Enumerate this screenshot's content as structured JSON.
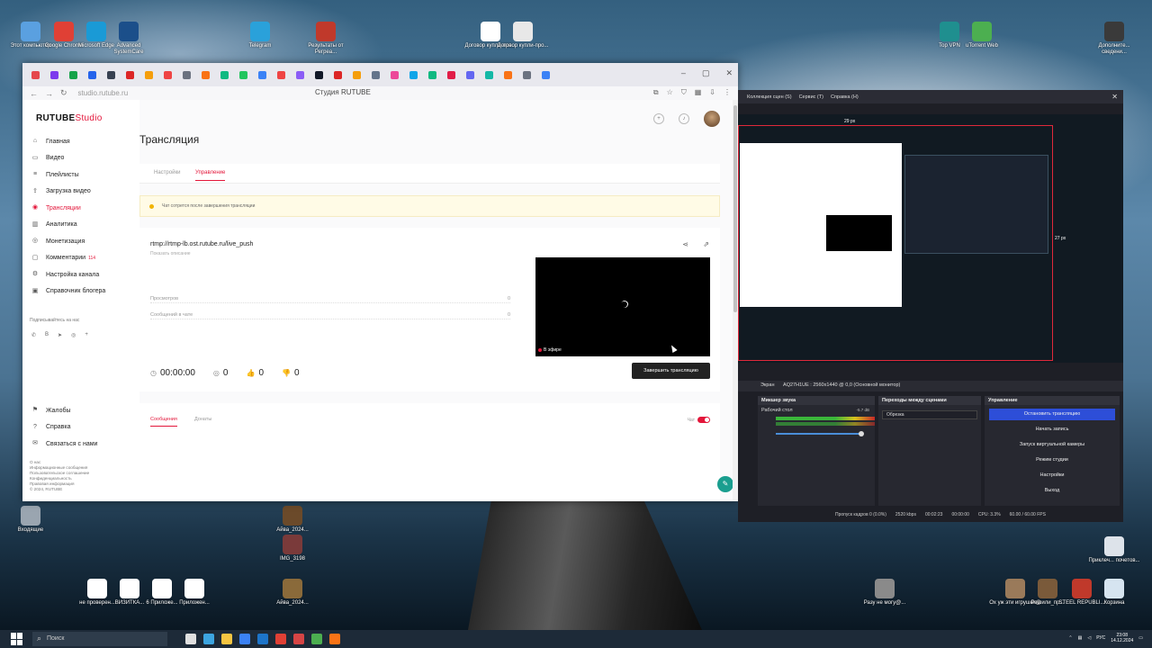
{
  "desktop": {
    "icons_top": [
      {
        "label": "Этот компьютер",
        "color": "#5aa0e0"
      },
      {
        "label": "Google Chrome",
        "color": "#e04035"
      },
      {
        "label": "Microsoft Edge",
        "color": "#1a9ad6"
      },
      {
        "label": "Advanced SystemCare",
        "color": "#1b4f8a"
      },
      {
        "label": "Telegram",
        "color": "#2aa1da"
      },
      {
        "label": "Результаты от Регреа...",
        "color": "#c0392b"
      },
      {
        "label": "Договор купли-про...",
        "color": "#ffffff"
      },
      {
        "label": "Договор купли-про...",
        "color": "#e8e8e8"
      }
    ],
    "icons_right": [
      {
        "label": "Top VPN",
        "color": "#1f8f8f"
      },
      {
        "label": "uTorrent Web",
        "color": "#4caf50"
      },
      {
        "label": "Дополните... сведени...",
        "color": "#3a3a3a"
      }
    ],
    "icons_bottom": [
      {
        "label": "не проверен...",
        "color": "#ffffff"
      },
      {
        "label": "ВИЗИТКА...",
        "color": "#ffffff"
      },
      {
        "label": "6 Приложе...",
        "color": "#ffffff"
      },
      {
        "label": "Приложен...",
        "color": "#ffffff"
      }
    ],
    "icons_bottom_mid": [
      {
        "label": "Айва_2024...",
        "color": "#6b4a2a"
      },
      {
        "label": "IMG_3198",
        "color": "#7a3a3a"
      },
      {
        "label": "Айва_2024...",
        "color": "#8a6a3a"
      }
    ],
    "icons_bottom_right": [
      {
        "label": "Разу не могу@...",
        "color": "#8a8a8a"
      },
      {
        "label": "Ох уж эти игрушки@",
        "color": "#9a7a5a"
      },
      {
        "label": "Решили_пр...",
        "color": "#7a5a3a"
      },
      {
        "label": "STEEL REPUBLI...",
        "color": "#c0392b"
      },
      {
        "label": "Корзина",
        "color": "#d6e4f0"
      }
    ],
    "icon_left_1": "Входящие",
    "icon_left_2": "Приклеч... почетов..."
  },
  "browser": {
    "url": "studio.rutube.ru",
    "page_title": "Студия RUTUBE",
    "tab_favicons": [
      "#e5484d",
      "#7c3aed",
      "#16a34a",
      "#2563eb",
      "#374151",
      "#dc2626",
      "#f59e0b",
      "#ef4444",
      "#6b7280",
      "#f97316",
      "#10b981",
      "#22c55e",
      "#3b82f6",
      "#ef4444",
      "#8b5cf6",
      "#111827",
      "#dc2626",
      "#f59e0b",
      "#64748b",
      "#ec4899",
      "#0ea5e9",
      "#10b981",
      "#e11d48",
      "#6366f1",
      "#14b8a6",
      "#f97316",
      "#6b7280",
      "#3b82f6"
    ]
  },
  "app": {
    "logo_main": "RUTUBE",
    "logo_sub": "Studio",
    "menu": [
      {
        "label": "Главная",
        "icon": "⌂"
      },
      {
        "label": "Видео",
        "icon": "▭"
      },
      {
        "label": "Плейлисты",
        "icon": "≡"
      },
      {
        "label": "Загрузка видео",
        "icon": "⇪"
      },
      {
        "label": "Трансляции",
        "icon": "◉"
      },
      {
        "label": "Аналитика",
        "icon": "▥"
      },
      {
        "label": "Монетизация",
        "icon": "◎"
      },
      {
        "label": "Комментарии",
        "icon": "▢",
        "badge": "114"
      },
      {
        "label": "Настройка канала",
        "icon": "⚙"
      },
      {
        "label": "Справочник блогера",
        "icon": "▣"
      }
    ],
    "follow_label": "Подписывайтесь на нас",
    "socials": [
      "✆",
      "В",
      "➤",
      "◎",
      "+"
    ],
    "menu2": [
      {
        "label": "Жалобы",
        "icon": "⚑"
      },
      {
        "label": "Справка",
        "icon": "?"
      },
      {
        "label": "Связаться с нами",
        "icon": "✉"
      }
    ],
    "footer_links": [
      "О нас",
      "Информационные сообщения",
      "Пользовательское соглашение",
      "Конфиденциальность",
      "Правовая информация",
      "© 2024, RUTUBE"
    ],
    "page_title": "Трансляция",
    "tabs": [
      "Настройки",
      "Управление"
    ],
    "alert": "Чат сотрется после завершения трансляции",
    "rtmp": "rtmp://rtmp-lb.ost.rutube.ru/live_push",
    "show_key": "Показать описание",
    "stats": [
      {
        "label": "Просмотров",
        "value": "0"
      },
      {
        "label": "Сообщений в чате",
        "value": "0"
      }
    ],
    "on_air": "В эфире",
    "timer": "00:00:00",
    "viewers": "0",
    "likes": "0",
    "dislikes": "0",
    "end_button": "Завершить трансляцию",
    "chat_tabs": [
      "Сообщения",
      "Донаты"
    ],
    "chat_label": "Чат"
  },
  "obs": {
    "menu": [
      "Коллекция сцен (S)",
      "Сервис (T)",
      "Справка (H)"
    ],
    "measure_top": "29 px",
    "measure_right": "27 px",
    "source_label": "Экран",
    "source_value": "AQ27H1UE : 2560x1440 @ 0,0 (Основной монитор)",
    "mixer_title": "Микшер звука",
    "mixer_source": "Рабочий стол",
    "mixer_db": "-5.7 dB",
    "transitions_title": "Переходы между сценами",
    "transition_value": "Обрезка",
    "controls_title": "Управление",
    "controls": [
      "Остановить трансляцию",
      "Начать запись",
      "Запуск виртуальной камеры",
      "Режим студии",
      "Настройки",
      "Выход"
    ],
    "status": {
      "dropped": "Пропуск кадров 0 (0.0%)",
      "bitrate": "2520 kbps",
      "live_time": "00:02:23",
      "rec_time": "00:00:00",
      "cpu": "CPU: 3.3%",
      "fps": "60.00 / 60.00 FPS"
    }
  },
  "taskbar": {
    "search": "Поиск",
    "icons": [
      "#e0e0e0",
      "#3da5e0",
      "#f5c542",
      "#3b82f6",
      "#1d74c9",
      "#e04035",
      "#d64545",
      "#4caf50",
      "#f97316"
    ],
    "lang": "РУС",
    "time": "23:08",
    "date": "14.12.2024"
  }
}
